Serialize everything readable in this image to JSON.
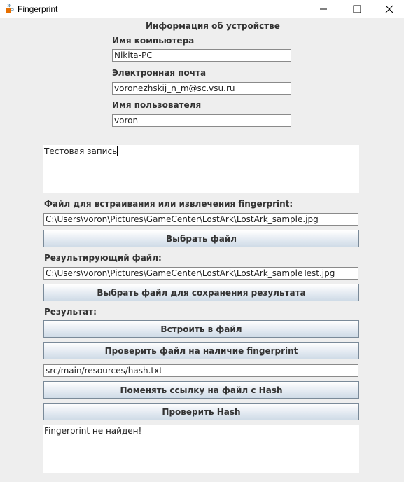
{
  "window": {
    "title": "Fingerprint",
    "icon": "java-cup-icon"
  },
  "device_info": {
    "heading": "Информация об устройстве",
    "computer_name_label": "Имя компьютера",
    "computer_name_value": "Nikita-PC",
    "email_label": "Электронная почта",
    "email_value": "voronezhskij_n_m@sc.vsu.ru",
    "username_label": "Имя пользователя",
    "username_value": "voron"
  },
  "text_record": "Тестовая запись",
  "source_file": {
    "label": "Файл для встраивания или извлечения fingerprint:",
    "path": "C:\\Users\\voron\\Pictures\\GameCenter\\LostArk\\LostArk_sample.jpg",
    "button": "Выбрать файл"
  },
  "result_file": {
    "label": "Результирующий файл:",
    "path": "C:\\Users\\voron\\Pictures\\GameCenter\\LostArk\\LostArk_sampleTest.jpg",
    "button": "Выбрать файл для сохранения результата"
  },
  "result": {
    "label": "Результат:",
    "embed_button": "Встроить в файл",
    "check_button": "Проверить файл на наличие fingerprint",
    "hash_path": "src/main/resources/hash.txt",
    "change_hash_button": "Поменять ссылку на файл с Hash",
    "verify_hash_button": "Проверить Hash",
    "output": "Fingerprint не найден!"
  }
}
